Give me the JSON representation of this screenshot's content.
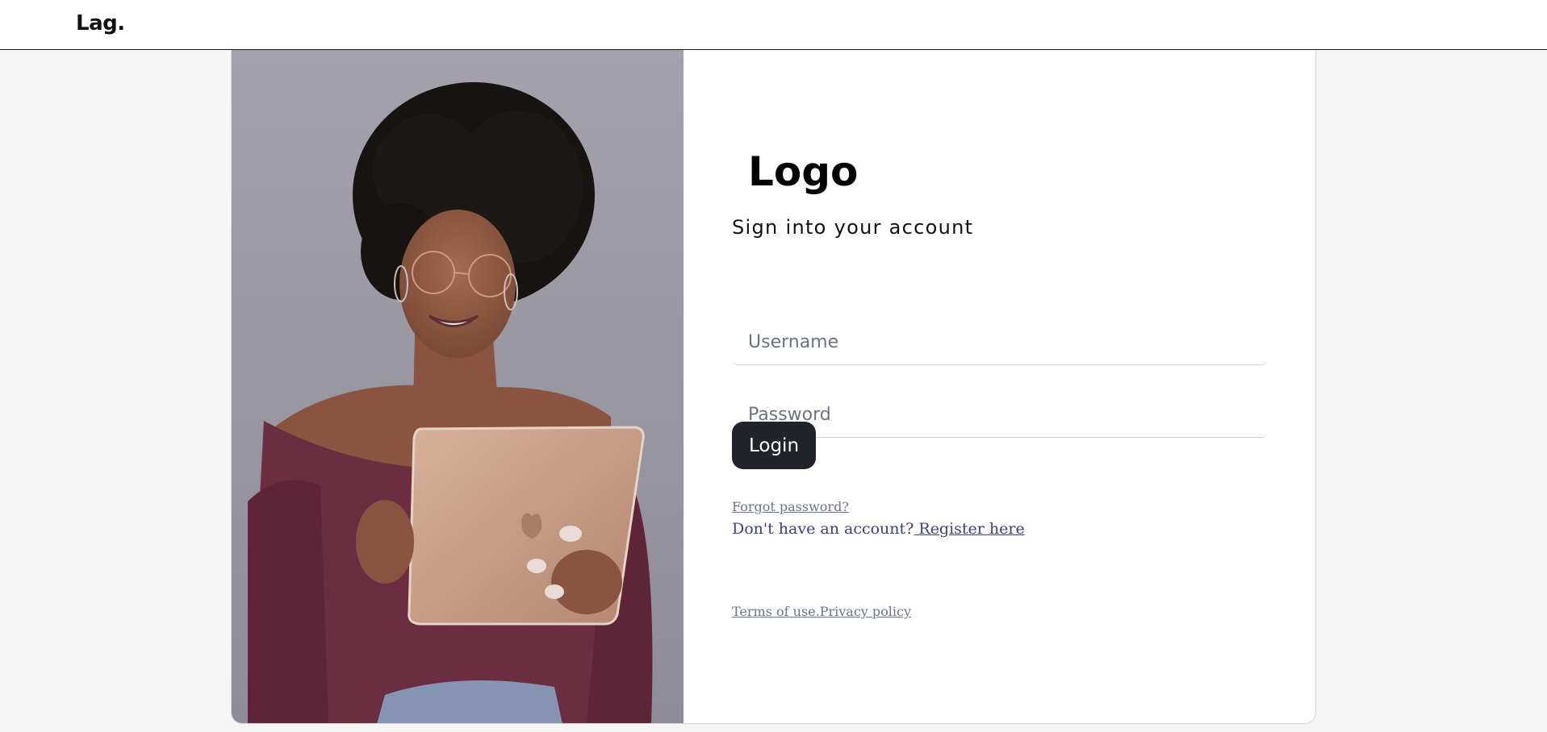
{
  "navbar": {
    "brand": "Lag."
  },
  "form": {
    "logo_text": "Logo",
    "subtitle": "Sign into your account",
    "username_placeholder": "Username",
    "password_placeholder": "Password",
    "login_label": "Login",
    "forgot_label": "Forgot password?",
    "no_account_text": "Don't have an account?",
    "register_label": " Register here",
    "terms_label": "Terms of use.",
    "privacy_label": "Privacy policy"
  },
  "colors": {
    "button_bg": "#212529",
    "register_link": "#393f81",
    "muted_link": "#6c757d"
  }
}
